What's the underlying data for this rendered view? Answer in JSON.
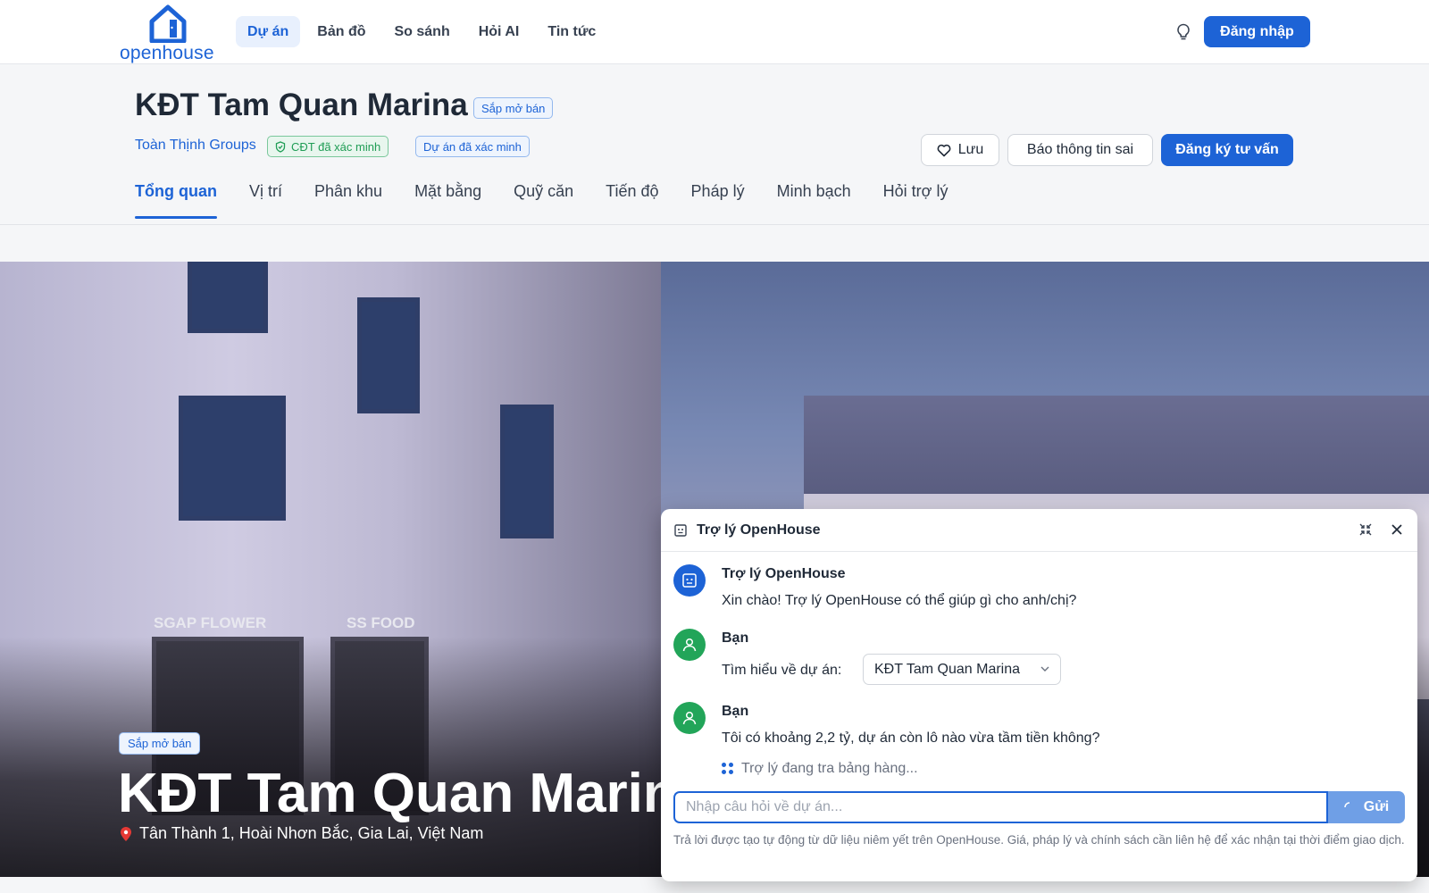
{
  "brand": {
    "name": "openhouse",
    "accent": "#1d63d6"
  },
  "nav": {
    "items": [
      {
        "label": "Dự án",
        "active": true
      },
      {
        "label": "Bản đồ",
        "active": false
      },
      {
        "label": "So sánh",
        "active": false
      },
      {
        "label": "Hỏi AI",
        "active": false
      },
      {
        "label": "Tin tức",
        "active": false
      }
    ],
    "login_label": "Đăng nhập",
    "theme_icon": "lightbulb-icon"
  },
  "project": {
    "title": "KĐT Tam Quan Marina",
    "status_badge": "Sắp mở bán",
    "developer": "Toàn Thịnh Groups",
    "developer_verified": "CĐT đã xác minh",
    "project_verified": "Dự án đã xác minh",
    "actions": {
      "save": "Lưu",
      "report": "Báo thông tin sai",
      "consult": "Đăng ký tư vấn"
    },
    "tabs": [
      {
        "label": "Tổng quan",
        "active": true
      },
      {
        "label": "Vị trí",
        "active": false
      },
      {
        "label": "Phân khu",
        "active": false
      },
      {
        "label": "Mặt bằng",
        "active": false
      },
      {
        "label": "Quỹ căn",
        "active": false
      },
      {
        "label": "Tiến độ",
        "active": false
      },
      {
        "label": "Pháp lý",
        "active": false
      },
      {
        "label": "Minh bạch",
        "active": false
      },
      {
        "label": "Hỏi trợ lý",
        "active": false
      }
    ]
  },
  "hero": {
    "badge": "Sắp mở bán",
    "title": "KĐT Tam Quan Marina",
    "address": "Tân Thành 1, Hoài Nhơn Bắc, Gia Lai, Việt Nam",
    "signs": [
      "SGAP FLOWER",
      "SS FOOD"
    ]
  },
  "chat": {
    "title": "Trợ lý OpenHouse",
    "messages": [
      {
        "sender": "Trợ lý OpenHouse",
        "text": "Xin chào! Trợ lý OpenHouse có thể giúp gì cho anh/chị?"
      },
      {
        "sender": "Bạn",
        "text": "Tìm hiểu về dự án:",
        "selected_project": "KĐT Tam Quan Marina"
      },
      {
        "sender": "Bạn",
        "text": "Tôi có khoảng 2,2 tỷ, dự án còn lô nào vừa tầm tiền không?"
      }
    ],
    "typing": "Trợ lý đang tra bảng hàng...",
    "input_placeholder": "Nhập câu hỏi về dự án...",
    "send_label": "Gửi",
    "disclaimer": "Trả lời được tạo tự động từ dữ liệu niêm yết trên OpenHouse. Giá, pháp lý và chính sách cần liên hệ để xác nhận tại thời điểm giao dịch."
  }
}
